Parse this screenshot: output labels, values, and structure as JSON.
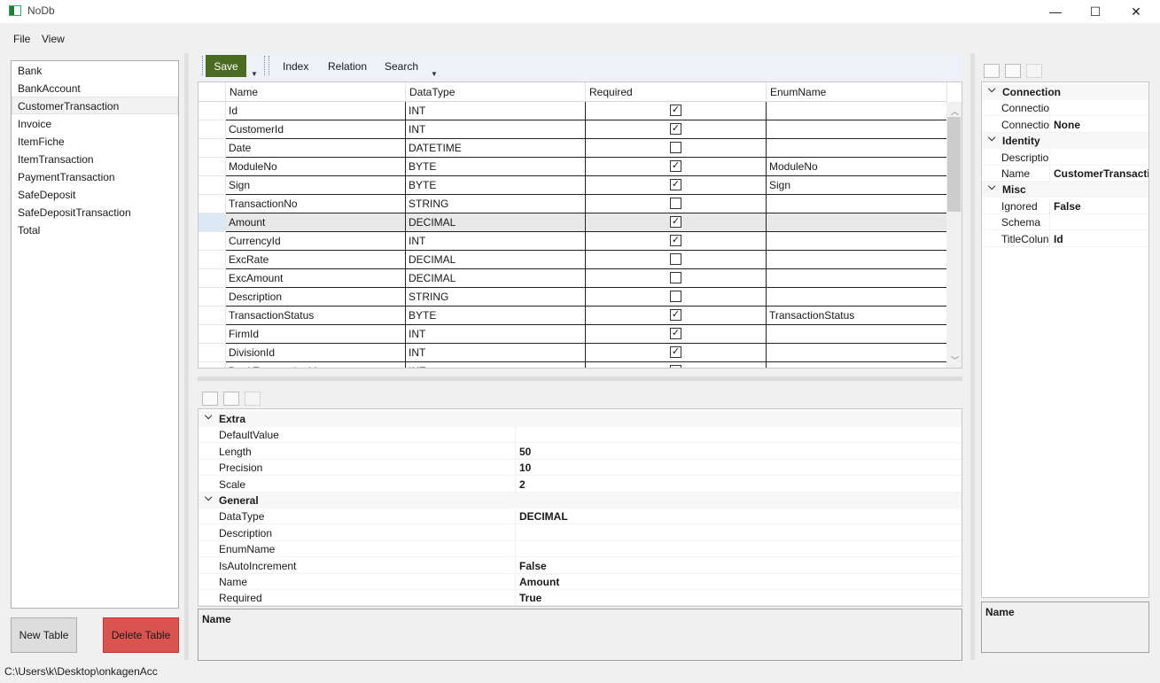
{
  "window": {
    "title": "NoDb",
    "minimize_glyph": "—",
    "maximize_glyph": "☐",
    "close_glyph": "✕"
  },
  "menu": [
    "File",
    "View"
  ],
  "tables": [
    "Bank",
    "BankAccount",
    "CustomerTransaction",
    "Invoice",
    "ItemFiche",
    "ItemTransaction",
    "PaymentTransaction",
    "SafeDeposit",
    "SafeDepositTransaction",
    "Total"
  ],
  "selected_table": "CustomerTransaction",
  "buttons": {
    "new_table": "New Table",
    "delete_table": "Delete Table"
  },
  "status_path": "C:\\Users\\k\\Desktop\\onkagenAcc",
  "toolbar": {
    "save": "Save",
    "index": "Index",
    "relation": "Relation",
    "search": "Search"
  },
  "grid": {
    "columns": [
      "Name",
      "DataType",
      "Required",
      "EnumName"
    ],
    "rows": [
      {
        "name": "Id",
        "type": "INT",
        "required": true,
        "enum": ""
      },
      {
        "name": "CustomerId",
        "type": "INT",
        "required": true,
        "enum": ""
      },
      {
        "name": "Date",
        "type": "DATETIME",
        "required": false,
        "enum": ""
      },
      {
        "name": "ModuleNo",
        "type": "BYTE",
        "required": true,
        "enum": "ModuleNo"
      },
      {
        "name": "Sign",
        "type": "BYTE",
        "required": true,
        "enum": "Sign"
      },
      {
        "name": "TransactionNo",
        "type": "STRING",
        "required": false,
        "enum": ""
      },
      {
        "name": "Amount",
        "type": "DECIMAL",
        "required": true,
        "enum": ""
      },
      {
        "name": "CurrencyId",
        "type": "INT",
        "required": true,
        "enum": ""
      },
      {
        "name": "ExcRate",
        "type": "DECIMAL",
        "required": false,
        "enum": ""
      },
      {
        "name": "ExcAmount",
        "type": "DECIMAL",
        "required": false,
        "enum": ""
      },
      {
        "name": "Description",
        "type": "STRING",
        "required": false,
        "enum": ""
      },
      {
        "name": "TransactionStatus",
        "type": "BYTE",
        "required": true,
        "enum": "TransactionStatus"
      },
      {
        "name": "FirmId",
        "type": "INT",
        "required": true,
        "enum": ""
      },
      {
        "name": "DivisionId",
        "type": "INT",
        "required": true,
        "enum": ""
      },
      {
        "name": "BankTransactionId",
        "type": "INT",
        "required": false,
        "enum": ""
      }
    ],
    "selected_row": "Amount"
  },
  "column_props": {
    "categories": [
      {
        "name": "Extra",
        "items": [
          {
            "k": "DefaultValue",
            "v": ""
          },
          {
            "k": "Length",
            "v": "50"
          },
          {
            "k": "Precision",
            "v": "10"
          },
          {
            "k": "Scale",
            "v": "2"
          }
        ]
      },
      {
        "name": "General",
        "items": [
          {
            "k": "DataType",
            "v": "DECIMAL"
          },
          {
            "k": "Description",
            "v": ""
          },
          {
            "k": "EnumName",
            "v": ""
          },
          {
            "k": "IsAutoIncrement",
            "v": "False"
          },
          {
            "k": "Name",
            "v": "Amount"
          },
          {
            "k": "Required",
            "v": "True"
          }
        ]
      }
    ],
    "description_title": "Name"
  },
  "table_props": {
    "categories": [
      {
        "name": "Connection",
        "items": [
          {
            "k": "Connectio",
            "v": ""
          },
          {
            "k": "Connectio",
            "v": "None"
          }
        ]
      },
      {
        "name": "Identity",
        "items": [
          {
            "k": "Descriptio",
            "v": ""
          },
          {
            "k": "Name",
            "v": "CustomerTransacti"
          }
        ]
      },
      {
        "name": "Misc",
        "items": [
          {
            "k": "Ignored",
            "v": "False"
          },
          {
            "k": "Schema",
            "v": ""
          },
          {
            "k": "TitleColun",
            "v": "Id"
          }
        ]
      }
    ],
    "description_title": "Name"
  },
  "colors": {
    "save_bg": "#4b6b23",
    "delete_bg": "#d9534f"
  }
}
